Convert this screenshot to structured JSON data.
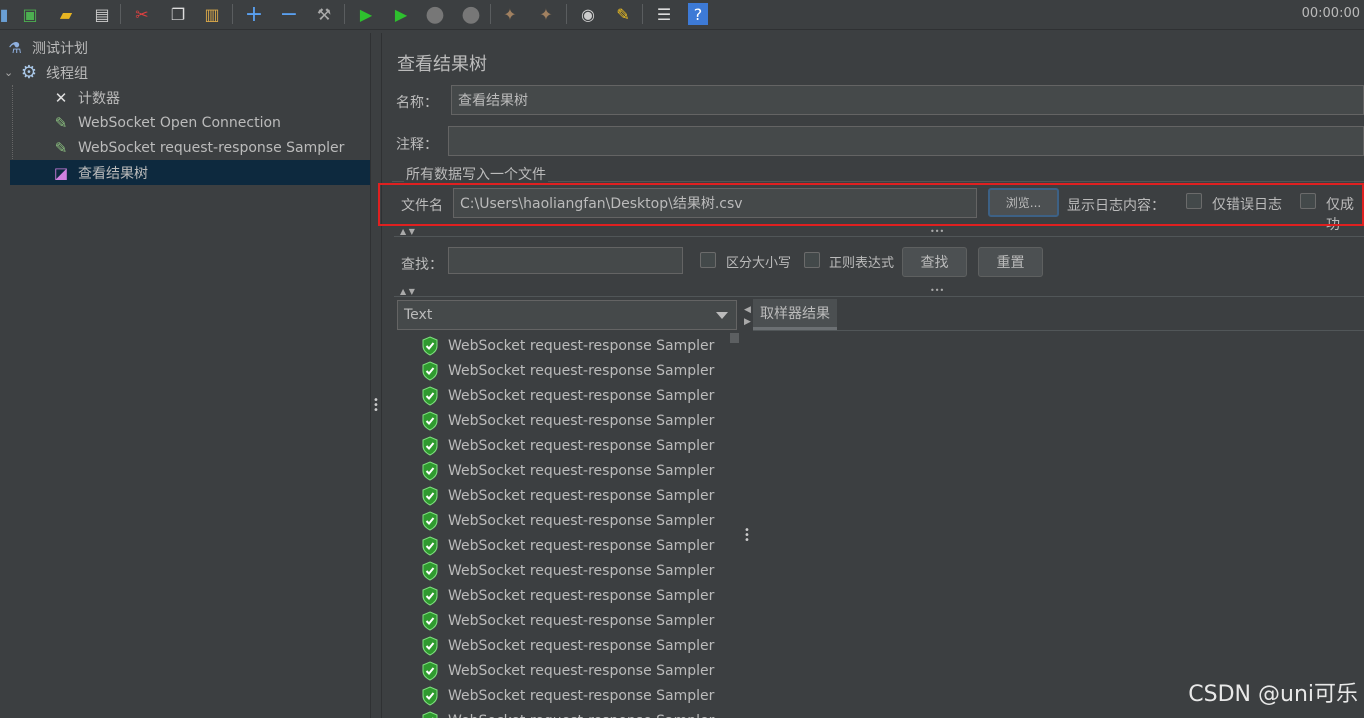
{
  "toolbar": {
    "icons": [
      "new-icon",
      "templates-icon",
      "open-icon",
      "save-icon",
      "cut-icon",
      "copy-icon",
      "paste-icon",
      "expand-icon",
      "collapse-icon",
      "toggle-icon",
      "start-icon",
      "start-no-pauses-icon",
      "stop-icon",
      "shutdown-icon",
      "clear-icon",
      "clear-all-icon",
      "search-icon",
      "reset-search-icon",
      "function-helper-icon",
      "help-icon"
    ],
    "timer": "00:00:00"
  },
  "tree": {
    "items": [
      {
        "label": "测试计划",
        "icon": "test-plan-icon"
      },
      {
        "label": "线程组",
        "icon": "gear-icon"
      },
      {
        "label": "计数器",
        "icon": "counter-icon"
      },
      {
        "label": "WebSocket Open Connection",
        "icon": "pipette-icon"
      },
      {
        "label": "WebSocket request-response Sampler",
        "icon": "pipette-icon"
      },
      {
        "label": "查看结果树",
        "icon": "listener-icon"
      }
    ]
  },
  "panel": {
    "title": "查看结果树",
    "name_label": "名称：",
    "name_value": "查看结果树",
    "comment_label": "注释：",
    "comment_value": "",
    "group_title": "所有数据写入一个文件",
    "filename_label": "文件名",
    "filename_value": "C:\\Users\\haoliangfan\\Desktop\\结果树.csv",
    "browse_label": "浏览...",
    "log_label": "显示日志内容：",
    "errors_only_label": "仅错误日志",
    "success_only_label": "仅成功",
    "search_label": "查找：",
    "search_value": "",
    "case_label": "区分大小写",
    "regex_label": "正则表达式",
    "find_button": "查找",
    "reset_button": "重置",
    "renderer_selected": "Text",
    "result_tab": "取样器结果"
  },
  "results": [
    "WebSocket request-response Sampler",
    "WebSocket request-response Sampler",
    "WebSocket request-response Sampler",
    "WebSocket request-response Sampler",
    "WebSocket request-response Sampler",
    "WebSocket request-response Sampler",
    "WebSocket request-response Sampler",
    "WebSocket request-response Sampler",
    "WebSocket request-response Sampler",
    "WebSocket request-response Sampler",
    "WebSocket request-response Sampler",
    "WebSocket request-response Sampler",
    "WebSocket request-response Sampler",
    "WebSocket request-response Sampler",
    "WebSocket request-response Sampler",
    "WebSocket request-response Sampler"
  ],
  "watermark": "CSDN @uni可乐",
  "colors": {
    "success": "#3fbf3f",
    "highlight": "#e02020",
    "selection": "#0d293e"
  }
}
